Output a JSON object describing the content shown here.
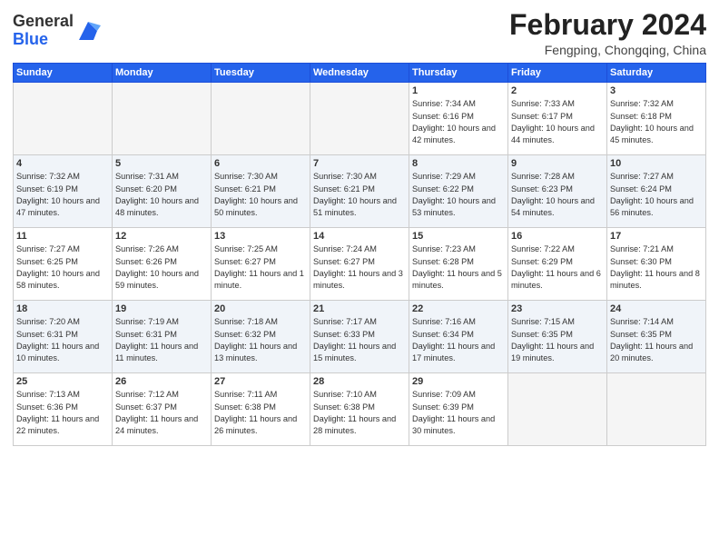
{
  "logo": {
    "general": "General",
    "blue": "Blue"
  },
  "header": {
    "title": "February 2024",
    "subtitle": "Fengping, Chongqing, China"
  },
  "weekdays": [
    "Sunday",
    "Monday",
    "Tuesday",
    "Wednesday",
    "Thursday",
    "Friday",
    "Saturday"
  ],
  "weeks": [
    [
      {
        "day": "",
        "empty": true
      },
      {
        "day": "",
        "empty": true
      },
      {
        "day": "",
        "empty": true
      },
      {
        "day": "",
        "empty": true
      },
      {
        "day": "1",
        "sunrise": "7:34 AM",
        "sunset": "6:16 PM",
        "daylight": "10 hours and 42 minutes."
      },
      {
        "day": "2",
        "sunrise": "7:33 AM",
        "sunset": "6:17 PM",
        "daylight": "10 hours and 44 minutes."
      },
      {
        "day": "3",
        "sunrise": "7:32 AM",
        "sunset": "6:18 PM",
        "daylight": "10 hours and 45 minutes."
      }
    ],
    [
      {
        "day": "4",
        "sunrise": "7:32 AM",
        "sunset": "6:19 PM",
        "daylight": "10 hours and 47 minutes."
      },
      {
        "day": "5",
        "sunrise": "7:31 AM",
        "sunset": "6:20 PM",
        "daylight": "10 hours and 48 minutes."
      },
      {
        "day": "6",
        "sunrise": "7:30 AM",
        "sunset": "6:21 PM",
        "daylight": "10 hours and 50 minutes."
      },
      {
        "day": "7",
        "sunrise": "7:30 AM",
        "sunset": "6:21 PM",
        "daylight": "10 hours and 51 minutes."
      },
      {
        "day": "8",
        "sunrise": "7:29 AM",
        "sunset": "6:22 PM",
        "daylight": "10 hours and 53 minutes."
      },
      {
        "day": "9",
        "sunrise": "7:28 AM",
        "sunset": "6:23 PM",
        "daylight": "10 hours and 54 minutes."
      },
      {
        "day": "10",
        "sunrise": "7:27 AM",
        "sunset": "6:24 PM",
        "daylight": "10 hours and 56 minutes."
      }
    ],
    [
      {
        "day": "11",
        "sunrise": "7:27 AM",
        "sunset": "6:25 PM",
        "daylight": "10 hours and 58 minutes."
      },
      {
        "day": "12",
        "sunrise": "7:26 AM",
        "sunset": "6:26 PM",
        "daylight": "10 hours and 59 minutes."
      },
      {
        "day": "13",
        "sunrise": "7:25 AM",
        "sunset": "6:27 PM",
        "daylight": "11 hours and 1 minute."
      },
      {
        "day": "14",
        "sunrise": "7:24 AM",
        "sunset": "6:27 PM",
        "daylight": "11 hours and 3 minutes."
      },
      {
        "day": "15",
        "sunrise": "7:23 AM",
        "sunset": "6:28 PM",
        "daylight": "11 hours and 5 minutes."
      },
      {
        "day": "16",
        "sunrise": "7:22 AM",
        "sunset": "6:29 PM",
        "daylight": "11 hours and 6 minutes."
      },
      {
        "day": "17",
        "sunrise": "7:21 AM",
        "sunset": "6:30 PM",
        "daylight": "11 hours and 8 minutes."
      }
    ],
    [
      {
        "day": "18",
        "sunrise": "7:20 AM",
        "sunset": "6:31 PM",
        "daylight": "11 hours and 10 minutes."
      },
      {
        "day": "19",
        "sunrise": "7:19 AM",
        "sunset": "6:31 PM",
        "daylight": "11 hours and 11 minutes."
      },
      {
        "day": "20",
        "sunrise": "7:18 AM",
        "sunset": "6:32 PM",
        "daylight": "11 hours and 13 minutes."
      },
      {
        "day": "21",
        "sunrise": "7:17 AM",
        "sunset": "6:33 PM",
        "daylight": "11 hours and 15 minutes."
      },
      {
        "day": "22",
        "sunrise": "7:16 AM",
        "sunset": "6:34 PM",
        "daylight": "11 hours and 17 minutes."
      },
      {
        "day": "23",
        "sunrise": "7:15 AM",
        "sunset": "6:35 PM",
        "daylight": "11 hours and 19 minutes."
      },
      {
        "day": "24",
        "sunrise": "7:14 AM",
        "sunset": "6:35 PM",
        "daylight": "11 hours and 20 minutes."
      }
    ],
    [
      {
        "day": "25",
        "sunrise": "7:13 AM",
        "sunset": "6:36 PM",
        "daylight": "11 hours and 22 minutes."
      },
      {
        "day": "26",
        "sunrise": "7:12 AM",
        "sunset": "6:37 PM",
        "daylight": "11 hours and 24 minutes."
      },
      {
        "day": "27",
        "sunrise": "7:11 AM",
        "sunset": "6:38 PM",
        "daylight": "11 hours and 26 minutes."
      },
      {
        "day": "28",
        "sunrise": "7:10 AM",
        "sunset": "6:38 PM",
        "daylight": "11 hours and 28 minutes."
      },
      {
        "day": "29",
        "sunrise": "7:09 AM",
        "sunset": "6:39 PM",
        "daylight": "11 hours and 30 minutes."
      },
      {
        "day": "",
        "empty": true
      },
      {
        "day": "",
        "empty": true
      }
    ]
  ]
}
